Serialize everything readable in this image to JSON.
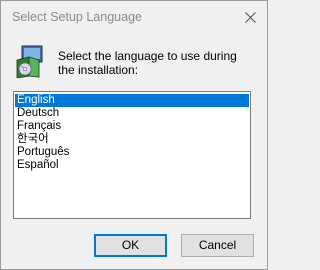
{
  "window": {
    "title": "Select Setup Language",
    "close_icon": "close-icon",
    "app_icon": "setup-installer-icon"
  },
  "prompt": {
    "line1": "Select the language to use during",
    "line2": "the installation:"
  },
  "languages": {
    "items": [
      "English",
      "Deutsch",
      "Français",
      "한국어",
      "Português",
      "Español"
    ],
    "selected": "English"
  },
  "buttons": {
    "ok": "OK",
    "cancel": "Cancel"
  },
  "colors": {
    "selection": "#0078d7",
    "background": "#f0f0f0"
  }
}
